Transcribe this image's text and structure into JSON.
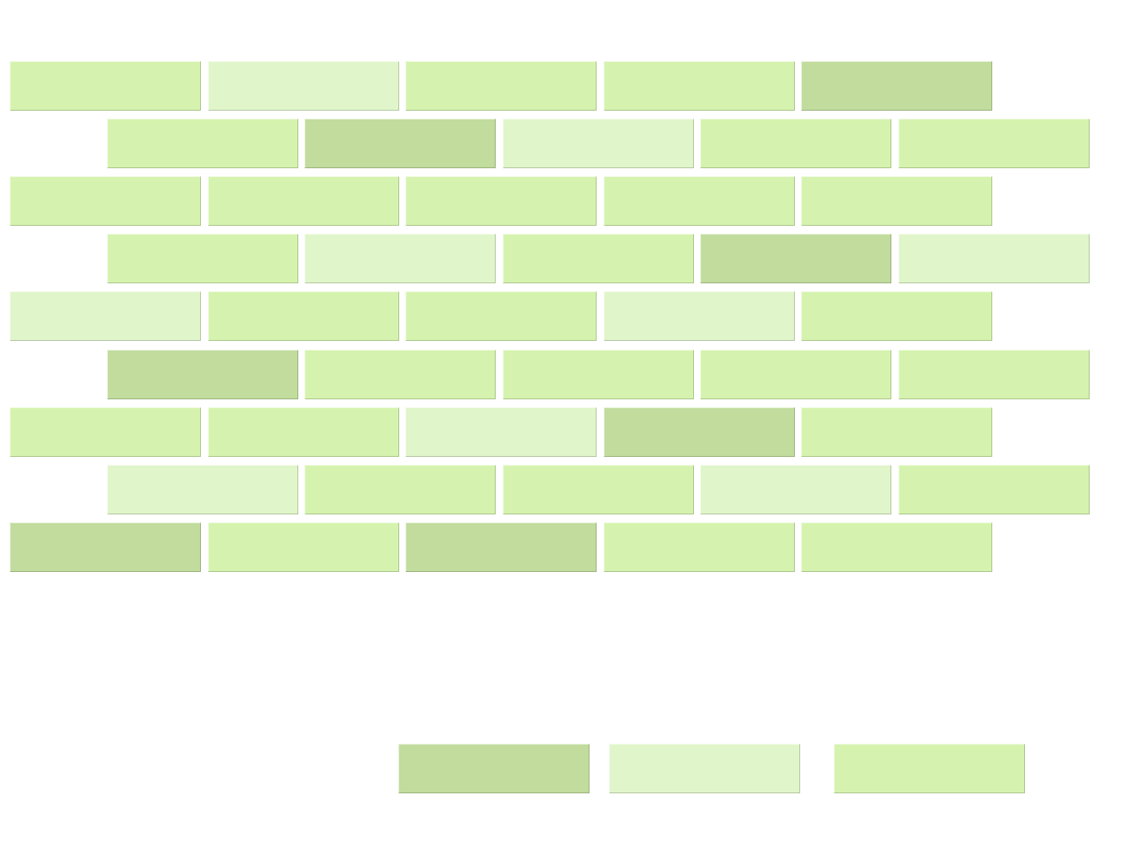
{
  "colors": {
    "dark": "#c1dc9d",
    "medium": "#d5f3ae",
    "light": "#e0f5c9"
  },
  "wall": {
    "rows": [
      [
        "medium",
        "light",
        "medium",
        "medium",
        "dark"
      ],
      [
        "medium",
        "dark",
        "light",
        "medium",
        "medium"
      ],
      [
        "medium",
        "medium",
        "medium",
        "medium",
        "medium"
      ],
      [
        "medium",
        "light",
        "medium",
        "dark",
        "light"
      ],
      [
        "light",
        "medium",
        "medium",
        "light",
        "medium"
      ],
      [
        "dark",
        "medium",
        "medium",
        "medium",
        "medium"
      ],
      [
        "medium",
        "medium",
        "light",
        "dark",
        "medium"
      ],
      [
        "light",
        "medium",
        "medium",
        "light",
        "medium"
      ],
      [
        "dark",
        "medium",
        "dark",
        "medium",
        "medium"
      ]
    ]
  },
  "palette": {
    "options": [
      "dark",
      "light",
      "medium"
    ]
  }
}
